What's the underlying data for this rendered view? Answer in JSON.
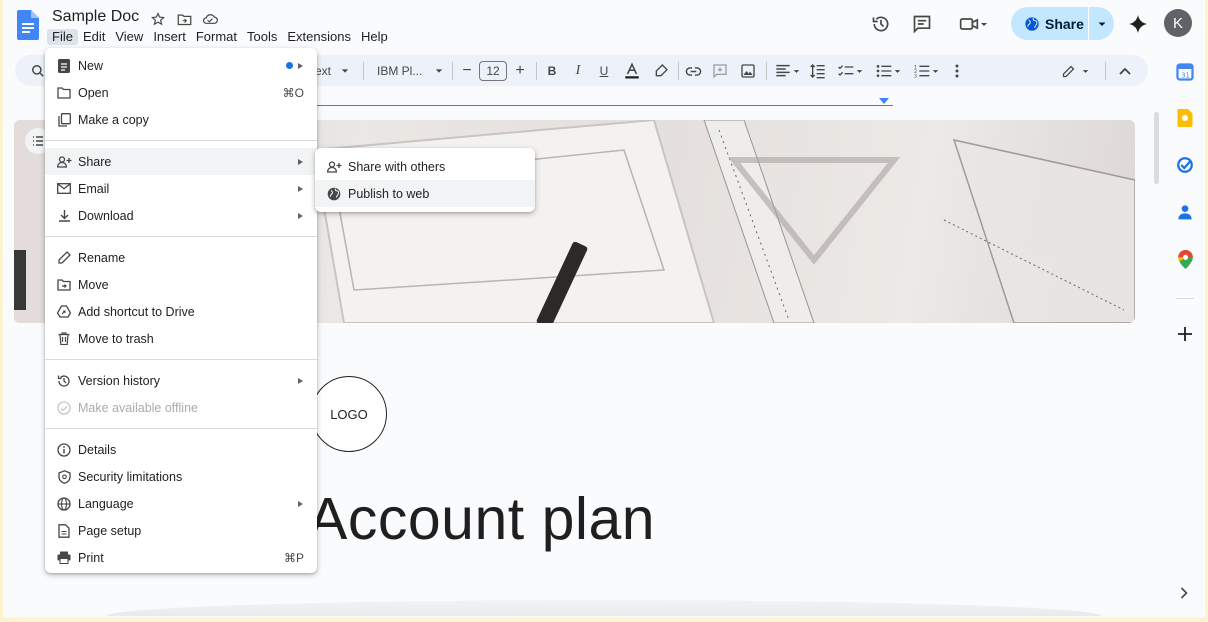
{
  "document": {
    "title": "Sample Doc",
    "logo_placeholder": "LOGO",
    "heading": "Account plan"
  },
  "menubar": [
    "File",
    "Edit",
    "View",
    "Insert",
    "Format",
    "Tools",
    "Extensions",
    "Help"
  ],
  "header": {
    "share_label": "Share",
    "avatar_initial": "K"
  },
  "toolbar": {
    "style_label": "ext",
    "font_name": "IBM Pl...",
    "font_size": "12"
  },
  "file_menu": {
    "new": "New",
    "open": "Open",
    "open_shortcut": "⌘O",
    "make_copy": "Make a copy",
    "share": "Share",
    "email": "Email",
    "download": "Download",
    "rename": "Rename",
    "move": "Move",
    "add_shortcut": "Add shortcut to Drive",
    "trash": "Move to trash",
    "version_history": "Version history",
    "offline": "Make available offline",
    "details": "Details",
    "security": "Security limitations",
    "language": "Language",
    "page_setup": "Page setup",
    "print": "Print",
    "print_shortcut": "⌘P"
  },
  "share_submenu": {
    "share_with_others": "Share with others",
    "publish_to_web": "Publish to web"
  },
  "colors": {
    "accent": "#1a73e8",
    "share_button": "#c2e7ff",
    "app_background": "#f9fbfd",
    "frame": "#fdf3cf"
  }
}
